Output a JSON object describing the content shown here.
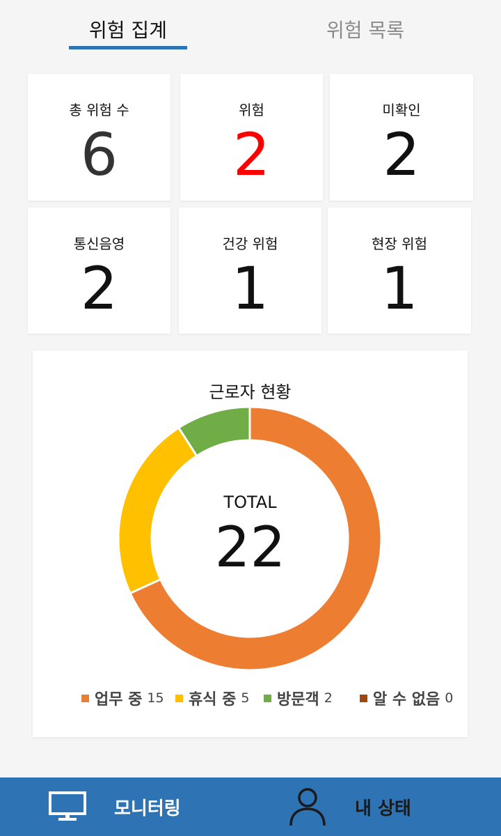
{
  "tabs": {
    "summary": "위험 집계",
    "list": "위험 목록"
  },
  "cards": [
    {
      "label": "총 위험 수",
      "value": "6",
      "color": "#333333"
    },
    {
      "label": "위험",
      "value": "2",
      "color": "#ff0000"
    },
    {
      "label": "미확인",
      "value": "2",
      "color": "#111111"
    },
    {
      "label": "통신음영",
      "value": "2",
      "color": "#111111"
    },
    {
      "label": "건강 위험",
      "value": "1",
      "color": "#111111"
    },
    {
      "label": "현장 위험",
      "value": "1",
      "color": "#111111"
    }
  ],
  "chart_data": {
    "type": "pie",
    "title": "근로자 현황",
    "center_label": "TOTAL",
    "center_value": "22",
    "categories": [
      "업무 중",
      "휴식 중",
      "방문객",
      "알 수 없음"
    ],
    "values": [
      15,
      5,
      2,
      0
    ],
    "colors": [
      "#ed7d31",
      "#ffc000",
      "#70ad47",
      "#9e480e"
    ],
    "legend_position": "bottom"
  },
  "bottom_nav": {
    "monitoring": "모니터링",
    "my_status": "내 상태"
  }
}
